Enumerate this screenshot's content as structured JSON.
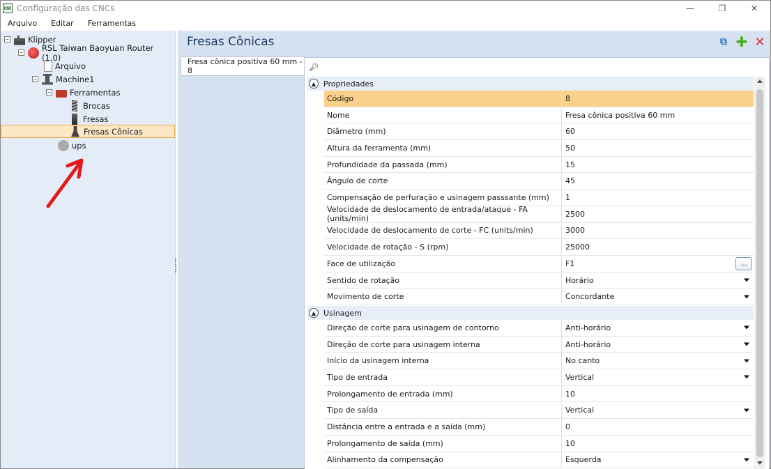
{
  "window": {
    "title": "Configuração das CNCs",
    "logo_text": "CNC",
    "controls": {
      "minimize": "—",
      "restore": "❐",
      "close": "✕"
    }
  },
  "menu": [
    "Arquivo",
    "Editar",
    "Ferramentas"
  ],
  "tree": {
    "items": [
      {
        "label": "Klipper",
        "icon": "factory-icon",
        "expander": "−"
      },
      {
        "label": "RSL Taiwan Baoyuan Router (1.0)",
        "icon": "machine-brand-icon",
        "expander": "−"
      },
      {
        "label": "Arquivo",
        "icon": "file-icon"
      },
      {
        "label": "Machine1",
        "icon": "cnc-machine-icon",
        "expander": "−"
      },
      {
        "label": "Ferramentas",
        "icon": "toolbox-icon",
        "expander": "−"
      },
      {
        "label": "Brocas",
        "icon": "drill-bit-icon"
      },
      {
        "label": "Fresas",
        "icon": "end-mill-icon"
      },
      {
        "label": "Fresas Cônicas",
        "icon": "cone-mill-icon"
      },
      {
        "label": "ups",
        "icon": "gear-icon"
      }
    ],
    "selected_index": 7
  },
  "main": {
    "title": "Fresas Cônicas",
    "header_icons": [
      "copy-icon",
      "add-icon",
      "delete-icon"
    ],
    "tool_list": [
      "Fresa cônica positiva 60 mm - 8"
    ],
    "search_icon": "key-icon",
    "categories": [
      {
        "name": "Propriedades",
        "rows": [
          {
            "label": "Código",
            "value": "8"
          },
          {
            "label": "Nome",
            "value": "Fresa cônica positiva 60 mm"
          },
          {
            "label": "Diâmetro (mm)",
            "value": "60"
          },
          {
            "label": "Altura da ferramenta (mm)",
            "value": "50"
          },
          {
            "label": "Profundidade da passada (mm)",
            "value": "15"
          },
          {
            "label": "Ângulo de corte",
            "value": "45"
          },
          {
            "label": "Compensação de perfuração e usinagem passsante (mm)",
            "value": "1"
          },
          {
            "label": "Velocidade de deslocamento de entrada/ataque - FA (units/min)",
            "value": "2500"
          },
          {
            "label": "Velocidade de deslocamento de corte - FC (units/min)",
            "value": "3000"
          },
          {
            "label": "Velocidade de rotação - S (rpm)",
            "value": "25000"
          },
          {
            "label": "Face de utilização",
            "value": "F1",
            "editor": "ellipsis",
            "editor_text": "..."
          },
          {
            "label": "Sentido de rotação",
            "value": "Horário",
            "editor": "dropdown"
          },
          {
            "label": "Movimento de corte",
            "value": "Concordante",
            "editor": "dropdown"
          }
        ]
      },
      {
        "name": "Usinagem",
        "rows": [
          {
            "label": "Direção de corte para usinagem de contorno",
            "value": "Anti-horário",
            "editor": "dropdown"
          },
          {
            "label": "Direção de corte para usinagem interna",
            "value": "Anti-horário",
            "editor": "dropdown"
          },
          {
            "label": "Início da usinagem interna",
            "value": "No canto",
            "editor": "dropdown"
          },
          {
            "label": "Tipo de entrada",
            "value": "Vertical",
            "editor": "dropdown"
          },
          {
            "label": "Prolongamento de entrada (mm)",
            "value": "10"
          },
          {
            "label": "Tipo de saída",
            "value": "Vertical",
            "editor": "dropdown"
          },
          {
            "label": "Distância entre a entrada e a saída (mm)",
            "value": "0"
          },
          {
            "label": "Prolongamento de saída (mm)",
            "value": "10"
          },
          {
            "label": "Alinhamento da compensação",
            "value": "Esquerda",
            "editor": "dropdown"
          }
        ]
      }
    ],
    "selected_row": "Código"
  },
  "colors": {
    "panel_bg": "#e4ecf7",
    "content_bg": "#d6e2f2",
    "selection": "#fbd08b",
    "tree_selection": "#fde7c5",
    "title_text": "#1e3a5f",
    "annotation_arrow": "#e01b1b"
  }
}
